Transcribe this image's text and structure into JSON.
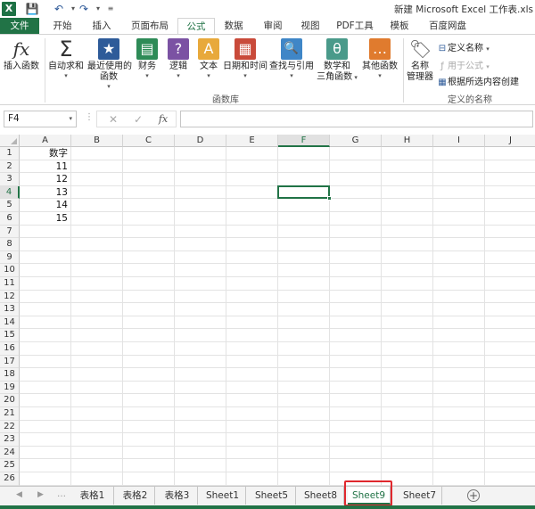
{
  "window": {
    "title": "新建 Microsoft Excel 工作表.xls"
  },
  "quick_access": {
    "logo": "X",
    "icons": [
      "save-icon",
      "undo-icon",
      "redo-icon",
      "customize-icon"
    ]
  },
  "ribbon_tabs": [
    {
      "label": "文件"
    },
    {
      "label": "开始"
    },
    {
      "label": "插入"
    },
    {
      "label": "页面布局"
    },
    {
      "label": "公式"
    },
    {
      "label": "数据"
    },
    {
      "label": "审阅"
    },
    {
      "label": "视图"
    },
    {
      "label": "PDF工具"
    },
    {
      "label": "模板"
    },
    {
      "label": "百度网盘"
    }
  ],
  "ribbon": {
    "insert_function": "插入函数",
    "autosum": "自动求和",
    "recent": "最近使用的\n函数",
    "recent_l1": "最近使用的",
    "recent_l2": "函数",
    "financial": "财务",
    "logical": "逻辑",
    "text": "文本",
    "datetime": "日期和时间",
    "lookup": "查找与引用",
    "math_l1": "数学和",
    "math_l2": "三角函数",
    "other": "其他函数",
    "group_function_library": "函数库",
    "name_manager_l1": "名称",
    "name_manager_l2": "管理器",
    "define_name": "定义名称",
    "use_in_formula": "用于公式",
    "create_from_selection": "根据所选内容创建",
    "group_defined_names": "定义的名称",
    "icon_glyphs": {
      "fx": "fx",
      "sigma": "Σ",
      "star": "★",
      "question": "?",
      "text_a": "A",
      "lookup": "🔍",
      "theta": "θ",
      "dots": "…",
      "tag": "🏷"
    }
  },
  "formula_bar": {
    "name_box": "F4",
    "cancel_glyph": "✕",
    "enter_glyph": "✓",
    "fx_glyph": "fx",
    "formula": ""
  },
  "sheet": {
    "columns": [
      "A",
      "B",
      "C",
      "D",
      "E",
      "F",
      "G",
      "H",
      "I",
      "J"
    ],
    "rows": [
      "1",
      "2",
      "3",
      "4",
      "5",
      "6",
      "7",
      "8",
      "9",
      "10",
      "11",
      "12",
      "13",
      "14",
      "15",
      "16",
      "17",
      "18",
      "19",
      "20",
      "21",
      "22",
      "23",
      "24",
      "25",
      "26"
    ],
    "selected_column": "F",
    "selected_row": "4",
    "cells": {
      "A1": "数字",
      "A2": "11",
      "A3": "12",
      "A4": "13",
      "A5": "14",
      "A6": "15"
    }
  },
  "sheet_tabs": [
    {
      "label": "表格1"
    },
    {
      "label": "表格2"
    },
    {
      "label": "表格3"
    },
    {
      "label": "Sheet1"
    },
    {
      "label": "Sheet5"
    },
    {
      "label": "Sheet8"
    },
    {
      "label": "Sheet9"
    },
    {
      "label": "Sheet7"
    }
  ],
  "active_sheet": "Sheet9",
  "add_sheet_glyph": "+",
  "colors": {
    "accent": "#217346",
    "highlight": "#e0282e"
  }
}
